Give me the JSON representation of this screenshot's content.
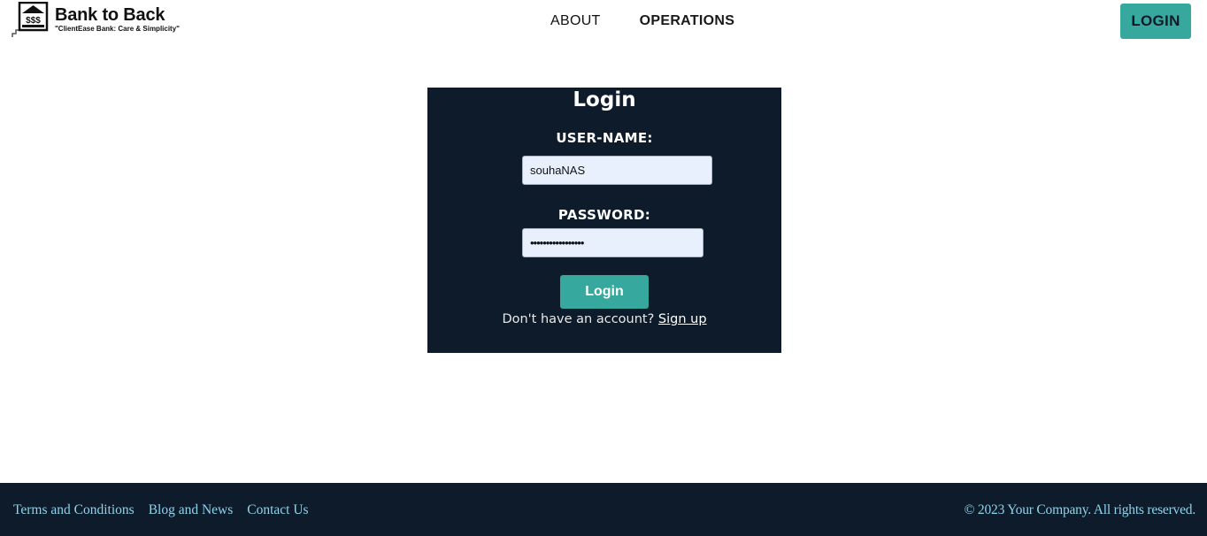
{
  "header": {
    "logo_title": "Bank to Back",
    "logo_tagline": "\"ClientEase Bank:  Care & Simplicity\"",
    "logo_icon_text": "$$$",
    "nav": [
      {
        "label": "ABOUT"
      },
      {
        "label": "OPERATIONS"
      }
    ],
    "login_button": "LOGIN"
  },
  "login_card": {
    "title": "Login",
    "username_label": "USER-NAME:",
    "username_value": "souhaNAS",
    "password_label": "PASSWORD:",
    "password_value": "•••••••••••••••••",
    "submit_label": "Login",
    "signup_prompt": "Don't have an account?",
    "signup_link": "Sign up"
  },
  "footer": {
    "links": [
      {
        "label": "Terms and Conditions"
      },
      {
        "label": "Blog and News"
      },
      {
        "label": "Contact Us"
      }
    ],
    "copyright": "© 2023 Your Company. All rights reserved."
  },
  "colors": {
    "accent": "#37a89e",
    "dark_navy": "#0e1b2b",
    "footer_link": "#8fd3ea",
    "input_bg": "#e8f0fe"
  }
}
